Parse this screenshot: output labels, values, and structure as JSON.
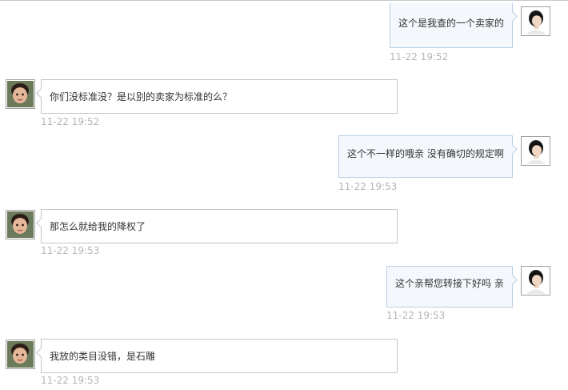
{
  "conversation": {
    "messages": [
      {
        "direction": "outgoing",
        "text": "这个是我查的一个卖家的",
        "time": "11-22 19:52",
        "avatar": "agent-avatar"
      },
      {
        "direction": "incoming",
        "text": "你们没标准没？是以别的卖家为标准的么？",
        "time": "11-22 19:52",
        "avatar": "customer-avatar"
      },
      {
        "direction": "outgoing",
        "text": "这个不一样的哦亲 没有确切的规定啊",
        "time": "11-22 19:53",
        "avatar": "agent-avatar"
      },
      {
        "direction": "incoming",
        "text": "那怎么就给我的降权了",
        "time": "11-22 19:53",
        "avatar": "customer-avatar"
      },
      {
        "direction": "outgoing",
        "text": "这个亲帮您转接下好吗 亲",
        "time": "11-22 19:53",
        "avatar": "agent-avatar"
      },
      {
        "direction": "incoming",
        "text": "我放的类目没错，是石雕",
        "time": "11-22 19:53",
        "avatar": "customer-avatar"
      }
    ]
  },
  "colors": {
    "incoming_bubble": "#ffffff",
    "outgoing_bubble": "#f4f8fd",
    "timestamp": "#b5b5b5"
  }
}
